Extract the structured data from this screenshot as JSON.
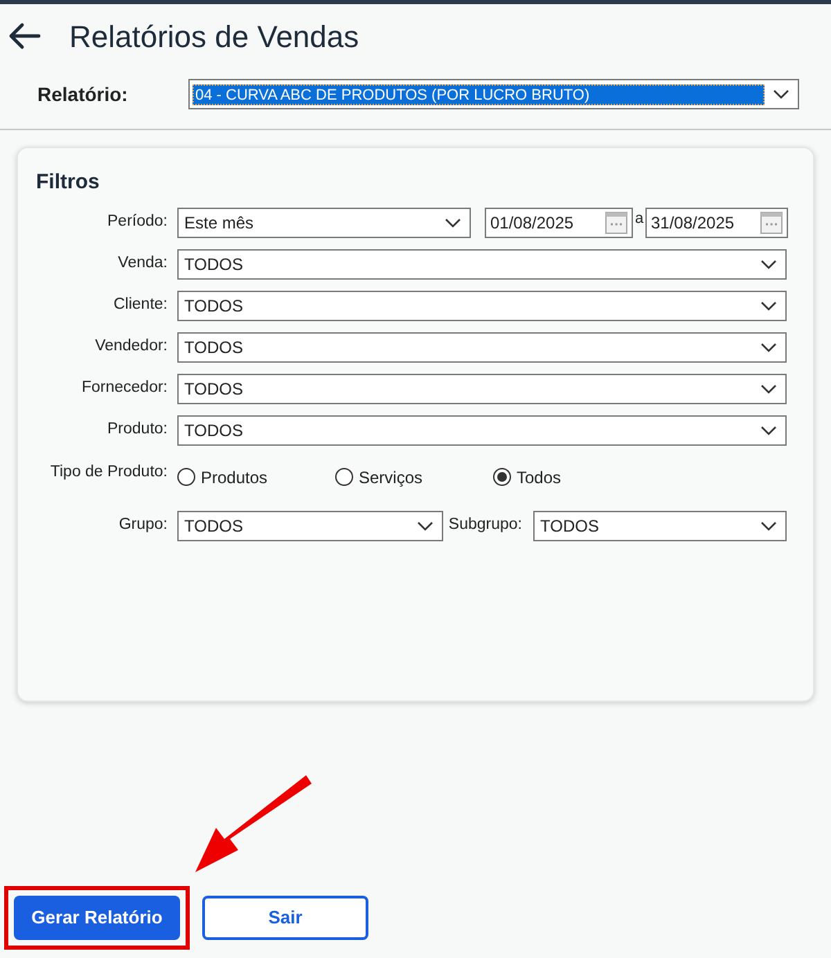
{
  "header": {
    "title": "Relatórios de Vendas"
  },
  "report": {
    "label": "Relatório:",
    "value": "04 - CURVA ABC DE PRODUTOS (POR LUCRO BRUTO)"
  },
  "filters": {
    "title": "Filtros",
    "rows": [
      {
        "kind": "period",
        "label": "Período:",
        "value": "Este mês",
        "from": "01/08/2025",
        "separator": "a",
        "to": "31/08/2025"
      },
      {
        "kind": "select",
        "label": "Venda:",
        "value": "TODOS"
      },
      {
        "kind": "select",
        "label": "Cliente:",
        "value": "TODOS"
      },
      {
        "kind": "select",
        "label": "Vendedor:",
        "value": "TODOS"
      },
      {
        "kind": "select",
        "label": "Fornecedor:",
        "value": "TODOS"
      },
      {
        "kind": "select",
        "label": "Produto:",
        "value": "TODOS"
      },
      {
        "kind": "radio",
        "label": "Tipo de Produto:",
        "options": [
          {
            "label": "Produtos",
            "selected": false
          },
          {
            "label": "Serviços",
            "selected": false
          },
          {
            "label": "Todos",
            "selected": true
          }
        ]
      },
      {
        "kind": "pair",
        "label": "Grupo:",
        "value": "TODOS",
        "label2": "Subgrupo:",
        "value2": "TODOS"
      }
    ]
  },
  "buttons": [
    {
      "kind": "primary",
      "label": "Gerar Relatório",
      "highlighted": true
    },
    {
      "kind": "secondary",
      "label": "Sair",
      "highlighted": false
    }
  ]
}
